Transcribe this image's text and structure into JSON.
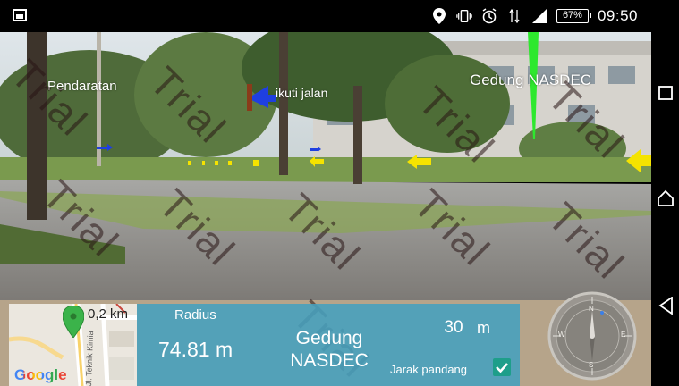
{
  "status_bar": {
    "battery": "67%",
    "time": "09:50"
  },
  "ar_view": {
    "watermark": "Trial",
    "labels": [
      {
        "text": "Pendaratan",
        "color": "#ffffff"
      },
      {
        "text": "ikuti jalan",
        "color": "#ffffff"
      },
      {
        "text": "Gedung NASDEC",
        "color": "#ffffff"
      }
    ],
    "arrow_color": "#f5e300",
    "direction_color": "#1f3fe0",
    "beam_color": "#2ee82e"
  },
  "minimap": {
    "distance": "0,2 km",
    "logo": "Google",
    "street": "Jl. Teknik Kimia",
    "pin_color": "#3bb34a"
  },
  "info_panel": {
    "radius_label": "Radius",
    "radius_value": "74.81 m",
    "target_line1": "Gedung",
    "target_line2": "NASDEC",
    "range_value": "30",
    "range_unit": "m",
    "visibility_label": "Jarak pandang",
    "panel_color": "#46a0be"
  },
  "compass": {
    "n": "N",
    "e": "E",
    "s": "S",
    "w": "W"
  },
  "nav_bar": {
    "recents": "recents-icon",
    "home": "home-icon",
    "back": "back-icon"
  }
}
